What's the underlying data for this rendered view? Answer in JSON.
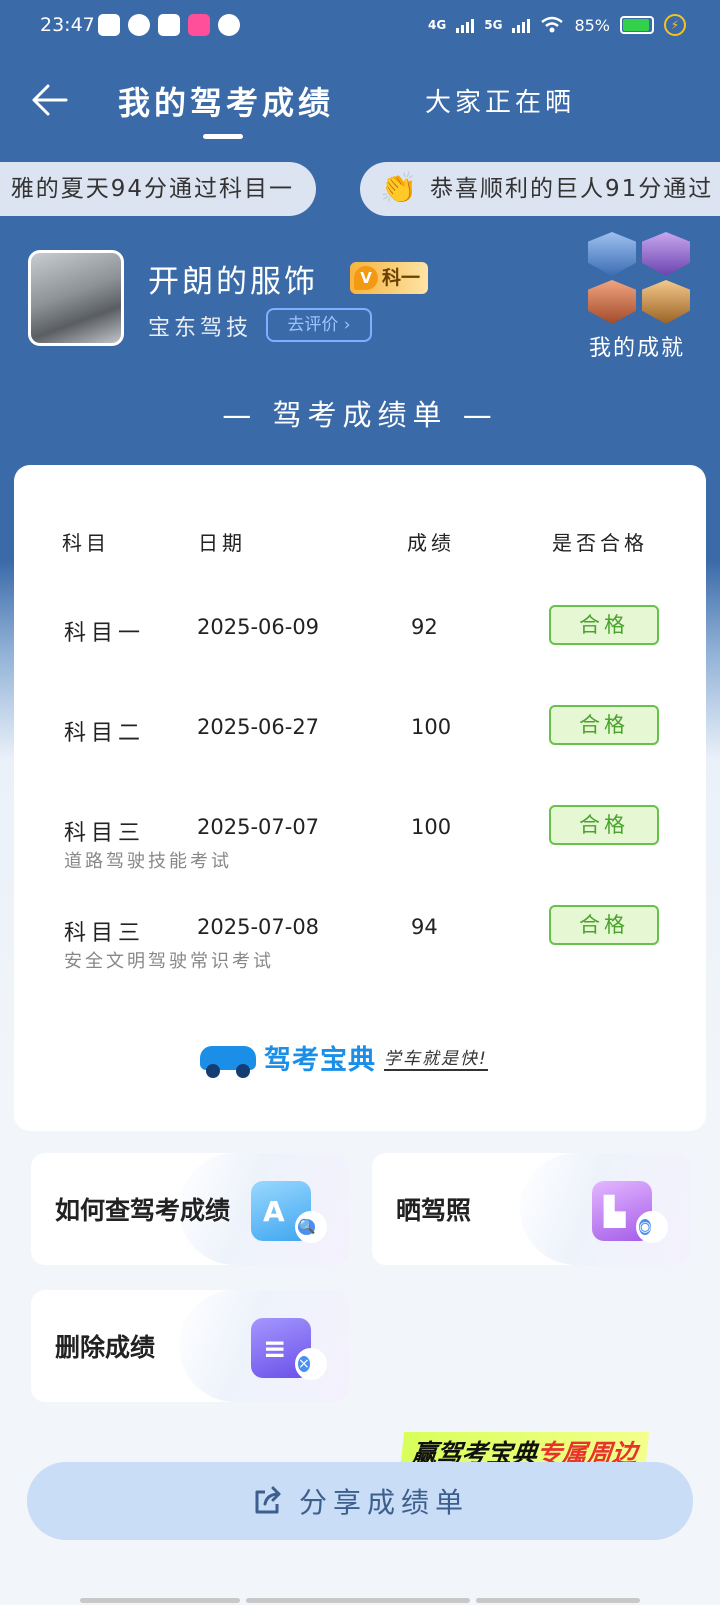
{
  "status_bar": {
    "time": "23:47",
    "signal1": "4G",
    "signal2": "5G",
    "battery": "85%",
    "battery_level": 0.85
  },
  "nav": {
    "title": "我的驾考成绩",
    "tab_other": "大家正在晒"
  },
  "ticker": [
    {
      "text": "雅的夏天94分通过科目一"
    },
    {
      "text": "恭喜顺利的巨人91分通过"
    }
  ],
  "profile": {
    "name": "开朗的服饰",
    "vip_label": "科一",
    "school": "宝东驾技",
    "review_button": "去评价",
    "achievements_label": "我的成就"
  },
  "sheet": {
    "title": "— 驾考成绩单 —",
    "headers": {
      "subject": "科目",
      "date": "日期",
      "score": "成绩",
      "pass": "是否合格"
    },
    "rows": [
      {
        "subject": "科目一",
        "date": "2025-06-09",
        "score": "92",
        "status": "合格",
        "sub": ""
      },
      {
        "subject": "科目二",
        "date": "2025-06-27",
        "score": "100",
        "status": "合格",
        "sub": ""
      },
      {
        "subject": "科目三",
        "date": "2025-07-07",
        "score": "100",
        "status": "合格",
        "sub": "道路驾驶技能考试"
      },
      {
        "subject": "科目三",
        "date": "2025-07-08",
        "score": "94",
        "status": "合格",
        "sub": "安全文明驾驶常识考试"
      }
    ],
    "brand_name": "驾考宝典",
    "brand_slogan": "学车就是快!"
  },
  "actions": {
    "query": "如何查驾考成绩",
    "license": "晒驾照",
    "delete": "删除成绩"
  },
  "promo": {
    "prefix": "赢驾考宝典",
    "highlight": "专属周边"
  },
  "share_button": "分享成绩单",
  "colors": {
    "primary": "#3b6aa8",
    "pass_green": "#4aa32c",
    "brand_blue": "#1b8fe8"
  }
}
